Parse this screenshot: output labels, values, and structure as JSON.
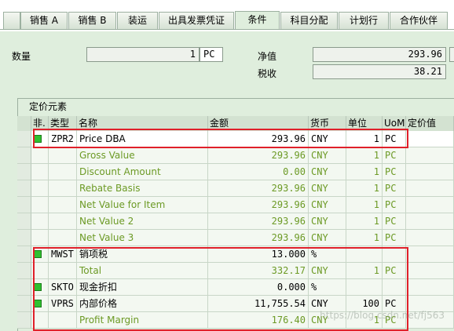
{
  "tabs": [
    {
      "label": "销售 A",
      "active": false
    },
    {
      "label": "销售 B",
      "active": false
    },
    {
      "label": "装运",
      "active": false
    },
    {
      "label": "出具发票凭证",
      "active": false
    },
    {
      "label": "条件",
      "active": true
    },
    {
      "label": "科目分配",
      "active": false
    },
    {
      "label": "计划行",
      "active": false
    },
    {
      "label": "合作伙伴",
      "active": false
    }
  ],
  "header": {
    "quantity_label": "数量",
    "quantity_value": "1",
    "quantity_unit": "PC",
    "net_label": "净值",
    "net_value": "293.96",
    "tax_label": "税收",
    "tax_value": "38.21"
  },
  "pricing": {
    "title": "定价元素",
    "columns": [
      "非.",
      "类型",
      "名称",
      "金额",
      "货币",
      "单位",
      "UoM",
      "定价值"
    ],
    "rows": [
      {
        "status": true,
        "type": "ZPR2",
        "name": "Price DBA",
        "amount": "293.96",
        "currency": "CNY",
        "per": "1",
        "uom": "PC",
        "subtotal": false,
        "highlight": true
      },
      {
        "status": false,
        "type": "",
        "name": "Gross Value",
        "amount": "293.96",
        "currency": "CNY",
        "per": "1",
        "uom": "PC",
        "subtotal": true
      },
      {
        "status": false,
        "type": "",
        "name": "Discount Amount",
        "amount": "0.00",
        "currency": "CNY",
        "per": "1",
        "uom": "PC",
        "subtotal": true
      },
      {
        "status": false,
        "type": "",
        "name": "Rebate Basis",
        "amount": "293.96",
        "currency": "CNY",
        "per": "1",
        "uom": "PC",
        "subtotal": true
      },
      {
        "status": false,
        "type": "",
        "name": "Net Value for Item",
        "amount": "293.96",
        "currency": "CNY",
        "per": "1",
        "uom": "PC",
        "subtotal": true
      },
      {
        "status": false,
        "type": "",
        "name": "Net Value 2",
        "amount": "293.96",
        "currency": "CNY",
        "per": "1",
        "uom": "PC",
        "subtotal": true
      },
      {
        "status": false,
        "type": "",
        "name": "Net Value 3",
        "amount": "293.96",
        "currency": "CNY",
        "per": "1",
        "uom": "PC",
        "subtotal": true
      },
      {
        "status": true,
        "type": "MWST",
        "name": "销项税",
        "amount": "13.000",
        "currency": "%",
        "per": "",
        "uom": "",
        "subtotal": false
      },
      {
        "status": false,
        "type": "",
        "name": "Total",
        "amount": "332.17",
        "currency": "CNY",
        "per": "1",
        "uom": "PC",
        "subtotal": true
      },
      {
        "status": true,
        "type": "SKTO",
        "name": "现金折扣",
        "amount": "0.000",
        "currency": "%",
        "per": "",
        "uom": "",
        "subtotal": false
      },
      {
        "status": true,
        "type": "VPRS",
        "name": "内部价格",
        "amount": "11,755.54",
        "currency": "CNY",
        "per": "100",
        "uom": "PC",
        "subtotal": false
      },
      {
        "status": false,
        "type": "",
        "name": "Profit Margin",
        "amount": "176.40",
        "currency": "CNY",
        "per": "1",
        "uom": "PC",
        "subtotal": true
      }
    ]
  },
  "watermark": "https://blog.csdn.net/fj563",
  "colors": {
    "highlight": "#e0202a",
    "subtotal_text": "#6c9a25",
    "status_active": "#30c030"
  }
}
